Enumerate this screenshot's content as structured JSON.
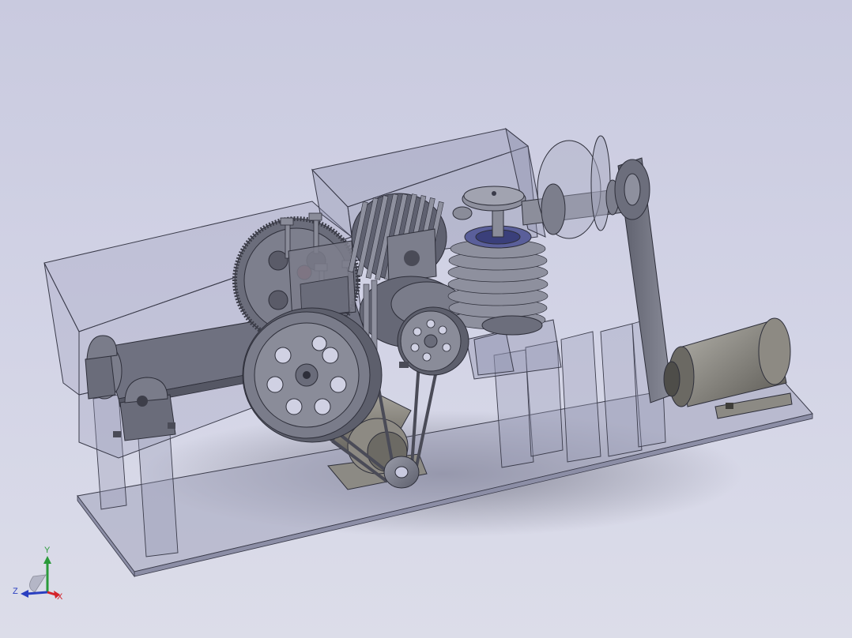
{
  "triad": {
    "x_label": "X",
    "y_label": "Y",
    "z_label": "Z"
  },
  "colors": {
    "background_top": "#c9cadf",
    "background_bottom": "#dcdde9",
    "transparent_panel": "#9b9db8",
    "edge": "#3a3b4a",
    "metal": "#7c7e8c",
    "metal_dark": "#4a4b57",
    "motor": "#8d8a83",
    "x_axis": "#d4232a",
    "y_axis": "#2a9a3a",
    "z_axis": "#2a3fc0"
  },
  "icons": {
    "triad": "coordinate-triad-icon"
  }
}
